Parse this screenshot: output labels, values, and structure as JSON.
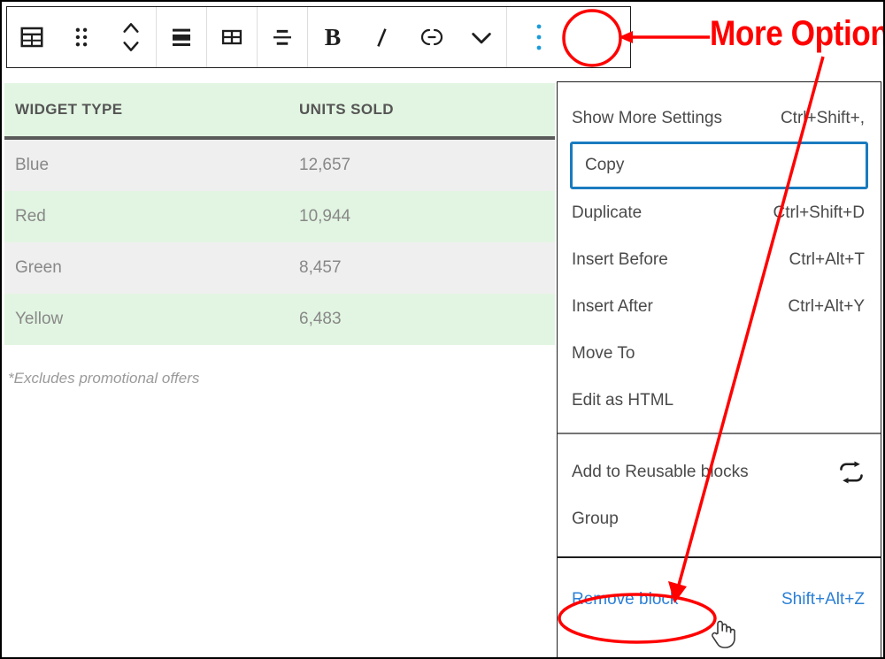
{
  "toolbar": {
    "groups": [
      {
        "name": "block-type-and-move",
        "buttons": [
          {
            "name": "table-block-type-icon",
            "icon": "table-icon",
            "label": "Table"
          },
          {
            "name": "drag-handle-icon",
            "icon": "drag-dots-icon",
            "label": "Drag"
          },
          {
            "name": "move-up-down-icon",
            "icon": "chevron-up-down-icon",
            "label": "Move up or down"
          }
        ]
      },
      {
        "name": "align-group",
        "buttons": [
          {
            "name": "change-alignment-icon",
            "icon": "align-icon",
            "label": "Change alignment"
          }
        ]
      },
      {
        "name": "edit-table-group",
        "buttons": [
          {
            "name": "edit-table-icon",
            "icon": "grid-icon",
            "label": "Edit table"
          }
        ]
      },
      {
        "name": "header-footer-group",
        "buttons": [
          {
            "name": "table-header-footer-icon",
            "icon": "header-footer-icon",
            "label": "Toggle header / footer"
          }
        ]
      },
      {
        "name": "text-format-group",
        "buttons": [
          {
            "name": "bold-button",
            "icon": "bold-icon",
            "label": "B"
          },
          {
            "name": "italic-button",
            "icon": "italic-icon",
            "label": "I"
          },
          {
            "name": "link-button",
            "icon": "link-icon",
            "label": "Link"
          },
          {
            "name": "more-rich-text-controls-button",
            "icon": "chevron-down-icon",
            "label": "More rich text controls"
          }
        ]
      },
      {
        "name": "options-group",
        "buttons": [
          {
            "name": "more-options-button",
            "icon": "vertical-ellipsis-icon",
            "label": "More options"
          }
        ]
      }
    ]
  },
  "table": {
    "headers": [
      "WIDGET TYPE",
      "UNITS SOLD"
    ],
    "rows": [
      {
        "type": "Blue",
        "units": "12,657"
      },
      {
        "type": "Red",
        "units": "10,944"
      },
      {
        "type": "Green",
        "units": "8,457"
      },
      {
        "type": "Yellow",
        "units": "6,483"
      }
    ],
    "caption": "*Excludes promotional offers",
    "colors": {
      "header_bg": "#e2f5e2",
      "row_odd_bg": "#efefef",
      "row_even_bg": "#e2f5e2",
      "header_rule": "#595959",
      "text": "#888888"
    }
  },
  "more_menu": {
    "sections": [
      {
        "name": "primary",
        "items": [
          {
            "label": "Show More Settings",
            "shortcut": "Ctrl+Shift+,",
            "state": "normal",
            "icon": null
          },
          {
            "label": "Copy",
            "shortcut": "",
            "state": "focused",
            "icon": null
          },
          {
            "label": "Duplicate",
            "shortcut": "Ctrl+Shift+D",
            "state": "normal",
            "icon": null
          },
          {
            "label": "Insert Before",
            "shortcut": "Ctrl+Alt+T",
            "state": "normal",
            "icon": null
          },
          {
            "label": "Insert After",
            "shortcut": "Ctrl+Alt+Y",
            "state": "normal",
            "icon": null
          },
          {
            "label": "Move To",
            "shortcut": "",
            "state": "normal",
            "icon": null
          },
          {
            "label": "Edit as HTML",
            "shortcut": "",
            "state": "normal",
            "icon": null
          }
        ]
      },
      {
        "name": "grouping",
        "items": [
          {
            "label": "Add to Reusable blocks",
            "shortcut": "",
            "state": "normal",
            "icon": "reusable-blocks-icon"
          },
          {
            "label": "Group",
            "shortcut": "",
            "state": "normal",
            "icon": null
          }
        ]
      },
      {
        "name": "destructive",
        "items": [
          {
            "label": "Remove block",
            "shortcut": "Shift+Alt+Z",
            "state": "danger",
            "icon": null
          }
        ]
      }
    ]
  },
  "annotation": {
    "label": "More Options",
    "color": "#ff0000",
    "highlight_targets": [
      "more-options-button",
      "remove-block-menu-item"
    ]
  }
}
